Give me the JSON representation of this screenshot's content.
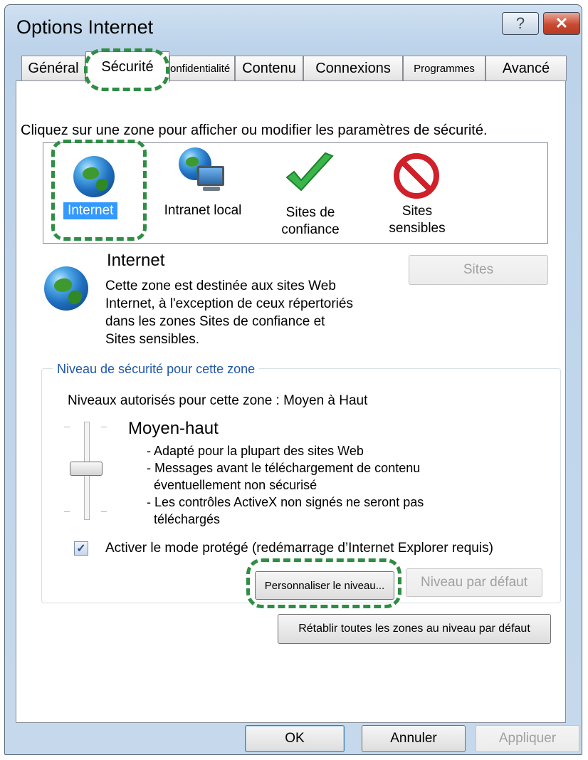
{
  "window": {
    "title": "Options Internet",
    "help_label": "?",
    "close_label": "✕"
  },
  "tabs": [
    {
      "label": "Général"
    },
    {
      "label": "Sécurité"
    },
    {
      "label": "onfidentialité"
    },
    {
      "label": "Contenu"
    },
    {
      "label": "Connexions"
    },
    {
      "label": "Programmes"
    },
    {
      "label": "Avancé"
    }
  ],
  "security": {
    "intro": "Cliquez sur une zone pour afficher ou modifier les paramètres de sécurité.",
    "zones": [
      {
        "line1": "Internet",
        "line2": "",
        "icon": "globe-icon"
      },
      {
        "line1": "Intranet local",
        "line2": "",
        "icon": "intranet-icon"
      },
      {
        "line1": "Sites de",
        "line2": "confiance",
        "icon": "checkmark-icon"
      },
      {
        "line1": "Sites",
        "line2": "sensibles",
        "icon": "restricted-icon"
      }
    ],
    "selected_zone": {
      "title": "Internet",
      "description_lines": [
        "Cette zone est destinée aux sites Web",
        "Internet, à l'exception de ceux répertoriés",
        "dans les zones Sites de confiance et",
        "Sites sensibles."
      ]
    },
    "sites_button": "Sites",
    "level_group": {
      "legend": "Niveau de sécurité pour cette zone",
      "allowed": "Niveaux autorisés pour cette zone : Moyen à Haut",
      "level_name": "Moyen-haut",
      "bullets": [
        "- Adapté pour la plupart des sites Web",
        "- Messages avant le téléchargement de contenu",
        "éventuellement non sécurisé",
        "- Les contrôles ActiveX non signés ne seront pas",
        "téléchargés"
      ],
      "slider_position": "Moyen-haut",
      "protected_mode_label": "Activer le mode protégé (redémarrage d’Internet Explorer requis)",
      "protected_mode_checked": true,
      "custom_level_button": "Personnaliser le niveau...",
      "default_level_button": "Niveau par défaut"
    },
    "reset_all_button": "Rétablir toutes les zones au niveau par défaut"
  },
  "footer": {
    "ok": "OK",
    "cancel": "Annuler",
    "apply": "Appliquer"
  },
  "colors": {
    "highlight_dash": "#2f8d44",
    "selection": "#3399ff",
    "legend_text": "#1f56a8"
  }
}
